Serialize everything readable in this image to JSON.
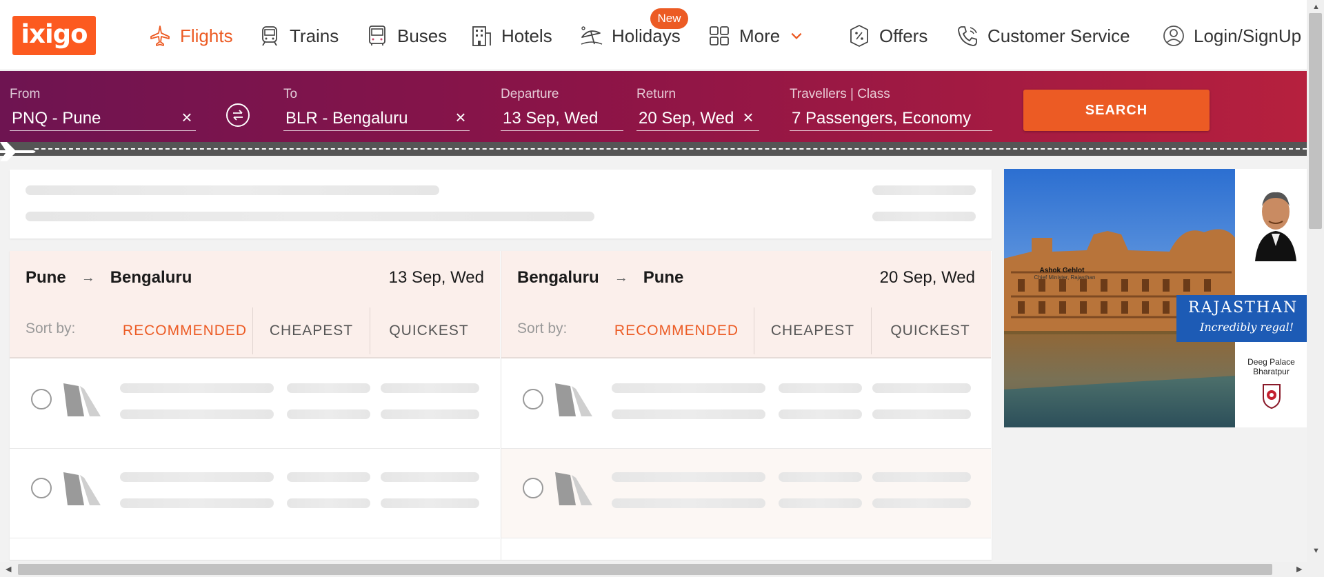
{
  "header": {
    "logo": "ixigo",
    "nav": [
      {
        "label": "Flights",
        "icon": "airplane-icon",
        "active": true
      },
      {
        "label": "Trains",
        "icon": "train-icon"
      },
      {
        "label": "Buses",
        "icon": "bus-icon"
      },
      {
        "label": "Hotels",
        "icon": "hotel-icon"
      },
      {
        "label": "Holidays",
        "icon": "beach-umbrella-icon",
        "badge": "New"
      },
      {
        "label": "More",
        "icon": "grid-icon"
      },
      {
        "label": "Offers",
        "icon": "offer-tag-icon"
      },
      {
        "label": "Customer Service",
        "icon": "phone-icon"
      },
      {
        "label": "Login/SignUp",
        "icon": "user-icon"
      }
    ],
    "accent_color": "#ec5b24"
  },
  "search": {
    "from_label": "From",
    "from_value": "PNQ - Pune",
    "to_label": "To",
    "to_value": "BLR - Bengaluru",
    "departure_label": "Departure",
    "departure_value": "13 Sep, Wed",
    "return_label": "Return",
    "return_value": "20 Sep, Wed",
    "travellers_label": "Travellers | Class",
    "travellers_value": "7 Passengers, Economy",
    "search_button": "SEARCH",
    "clear_icon": "×"
  },
  "results": {
    "outbound": {
      "from": "Pune",
      "to": "Bengaluru",
      "date": "13 Sep, Wed"
    },
    "return": {
      "from": "Bengaluru",
      "to": "Pune",
      "date": "20 Sep, Wed"
    },
    "sort_label": "Sort by:",
    "sort_options": [
      "RECOMMENDED",
      "CHEAPEST",
      "QUICKEST"
    ],
    "active_sort": "RECOMMENDED",
    "route_arrow": "→"
  },
  "ad": {
    "person_name": "Ashok Gehlot",
    "person_title": "Chief Minister, Rajasthan",
    "title": "RAJASTHAN",
    "tagline": "Incredibly regal!",
    "caption": "Deeg Palace Bharatpur"
  }
}
